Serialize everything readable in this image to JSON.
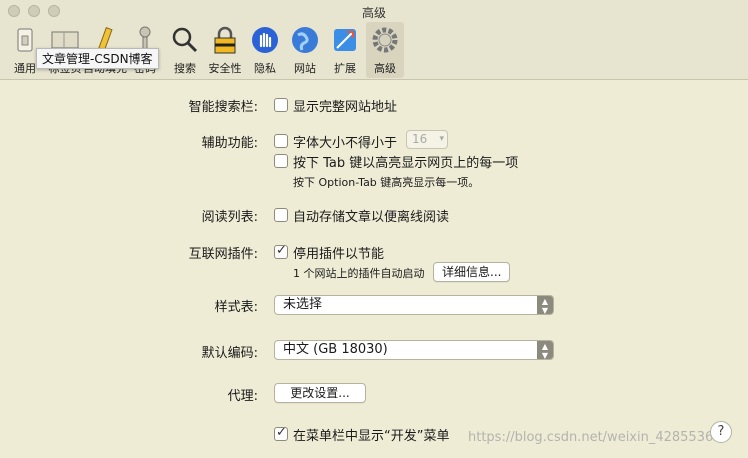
{
  "window": {
    "title": "高级"
  },
  "toolbar": {
    "items": [
      {
        "label": "通用",
        "icon": "switch-icon"
      },
      {
        "label": "标签页",
        "icon": "tabs-icon"
      },
      {
        "label": "自动填充",
        "icon": "pencil-icon"
      },
      {
        "label": "密码",
        "icon": "key-icon"
      },
      {
        "label": "搜索",
        "icon": "magnifier-icon"
      },
      {
        "label": "安全性",
        "icon": "lock-icon"
      },
      {
        "label": "隐私",
        "icon": "hand-icon"
      },
      {
        "label": "网站",
        "icon": "globe-icon"
      },
      {
        "label": "扩展",
        "icon": "puzzle-icon"
      },
      {
        "label": "高级",
        "icon": "gear-icon"
      }
    ],
    "tooltip": "文章管理-CSDN博客"
  },
  "settings": {
    "smart_search": {
      "label": "智能搜索栏:",
      "option": "显示完整网站地址"
    },
    "accessibility": {
      "label": "辅助功能:",
      "option1": "字体大小不得小于",
      "font_size": "16",
      "option2": "按下 Tab 键以高亮显示网页上的每一项",
      "hint": "按下 Option-Tab 键高亮显示每一项。"
    },
    "reading_list": {
      "label": "阅读列表:",
      "option": "自动存储文章以便离线阅读"
    },
    "plugins": {
      "label": "互联网插件:",
      "option": "停用插件以节能",
      "info": "1 个网站上的插件自动启动",
      "button": "详细信息..."
    },
    "stylesheet": {
      "label": "样式表:",
      "value": "未选择"
    },
    "encoding": {
      "label": "默认编码:",
      "value": "中文 (GB 18030)"
    },
    "proxy": {
      "label": "代理:",
      "button": "更改设置..."
    },
    "develop_menu": {
      "option": "在菜单栏中显示“开发”菜单"
    }
  },
  "watermark": "https://blog.csdn.net/weixin_42855362",
  "help": "?"
}
